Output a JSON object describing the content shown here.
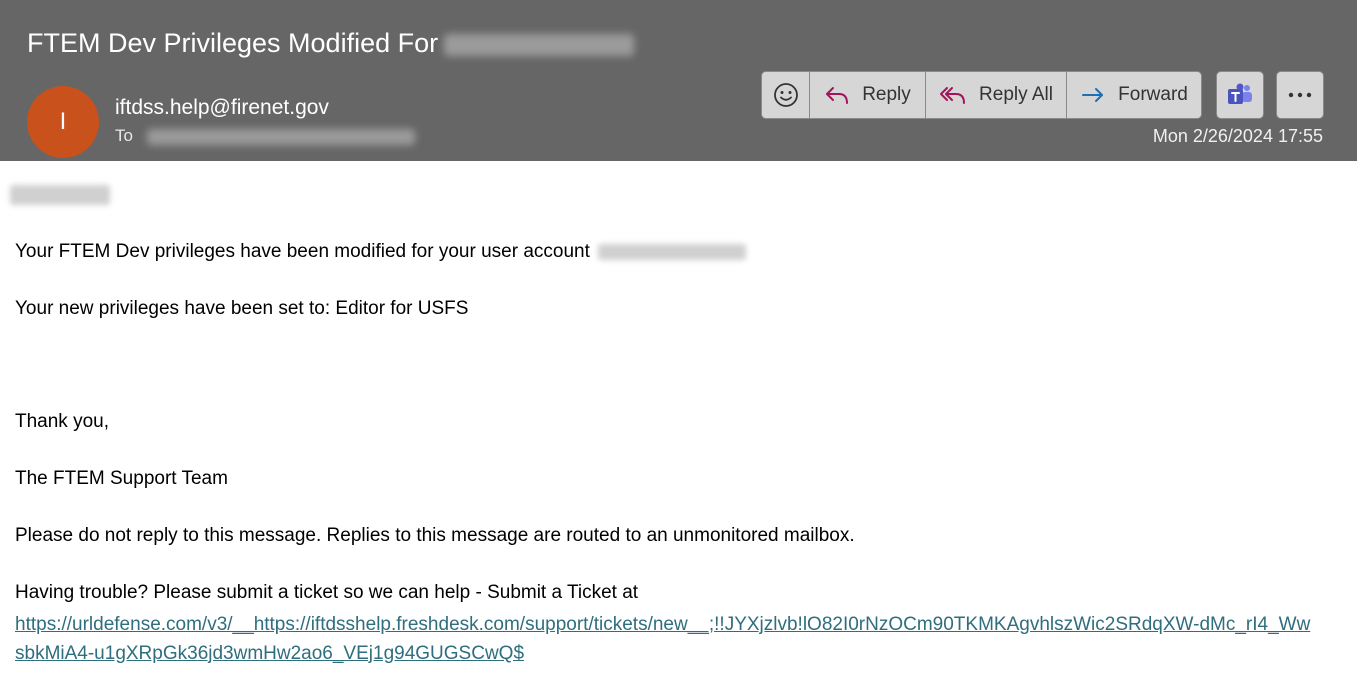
{
  "header": {
    "subject": "FTEM Dev Privileges Modified For",
    "avatar_initial": "I",
    "sender": "iftdss.help@firenet.gov",
    "to_label": "To",
    "date": "Mon 2/26/2024 17:55",
    "background": "#666666",
    "avatar_color": "#c9511c"
  },
  "toolbar": {
    "emoji_icon": "smiley-icon",
    "reply_label": "Reply",
    "reply_all_label": "Reply All",
    "forward_label": "Forward",
    "teams_icon": "teams-icon",
    "more_icon": "more-icon",
    "accent_reply": "#a3155a",
    "accent_forward": "#1f6fb2"
  },
  "body": {
    "line1": "Your FTEM Dev privileges have been modified for your user account",
    "line2": "Your new privileges have been set to: Editor for USFS",
    "line3": "Thank you,",
    "line4": "The FTEM Support Team",
    "line5": "Please do not reply to this message. Replies to this message are routed to an unmonitored mailbox.",
    "line6": "Having trouble? Please submit a ticket so we can help - Submit a Ticket at",
    "link": "https://urldefense.com/v3/__https://iftdsshelp.freshdesk.com/support/tickets/new__;!!JYXjzlvb!lO82I0rNzOCm90TKMKAgvhlszWic2SRdqXW-dMc_rI4_WwsbkMiA4-u1gXRpGk36jd3wmHw2ao6_VEj1g94GUGSCwQ$",
    "link_color": "#2e6e7e"
  }
}
